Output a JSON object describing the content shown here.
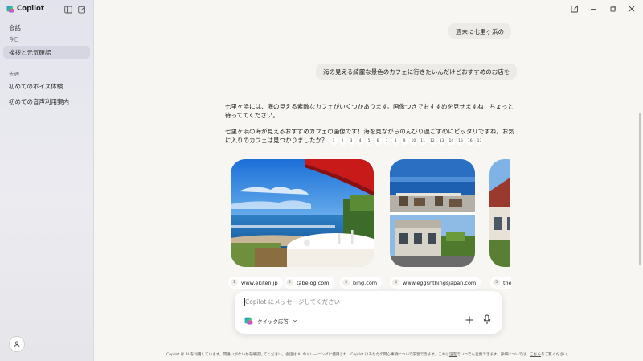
{
  "app": {
    "name": "Copilot"
  },
  "sidebar": {
    "section_title": "会話",
    "groups": [
      {
        "label": "今日",
        "items": [
          {
            "label": "挨拶と元気確認",
            "active": true
          }
        ]
      },
      {
        "label": "先週",
        "items": [
          {
            "label": "初めてのボイス体験",
            "active": false
          },
          {
            "label": "初めての音声利用案内",
            "active": false
          }
        ]
      }
    ]
  },
  "chat": {
    "user_messages": [
      "週末に七里ヶ浜の",
      "海の見える綺麗な景色のカフェに行きたいんだけどおすすめのお店を"
    ],
    "reply_paragraphs": [
      "七里ヶ浜には、海の見える素敵なカフェがいくつかあります。画像つきでおすすめを見せますね！ちょっと待っててください。",
      "七里ヶ浜の海が見えるおすすめカフェの画像です！海を見ながらのんびり過ごすのにピッタリですね。お気に入りのカフェは見つかりましたか？"
    ],
    "citations": [
      "1",
      "2",
      "3",
      "4",
      "5",
      "6",
      "7",
      "8",
      "9",
      "10",
      "11",
      "12",
      "13",
      "14",
      "15",
      "16",
      "17"
    ],
    "sources": [
      {
        "num": "1",
        "site": "www.ekiten.jp"
      },
      {
        "num": "2",
        "site": "tabelog.com"
      },
      {
        "num": "3",
        "site": "bing.com"
      },
      {
        "num": "4",
        "site": "www.eggsnthingsjapan.com"
      },
      {
        "num": "5",
        "site": "ther"
      }
    ]
  },
  "composer": {
    "placeholder": "Copilot にメッセージしてください",
    "mode_label": "クイック応答"
  },
  "footer": {
    "disclaimer_before": "Copilot は AI を利用しています。間違いがないかを確認してください。会話は AI のトレーニングに使用され、Copilot はあなたの関心事項について学習できます。これは",
    "settings_link": "設定",
    "disclaimer_middle": "でいつでも変更できます。詳細については、",
    "here_link": "こちら",
    "disclaimer_after": "をご覧ください。"
  },
  "colors": {
    "sidebar_bg": "#e6e6ee",
    "main_bg": "#f7f6f3",
    "bubble_bg": "#ecebe7",
    "active_item": "#d6d6e2"
  },
  "icons": [
    "copilot-logo-icon",
    "sidebar-toggle-icon",
    "new-chat-icon",
    "profile-icon",
    "pop-out-icon",
    "minimize-icon",
    "restore-icon",
    "close-icon",
    "plus-icon",
    "microphone-icon",
    "chevron-down-icon"
  ]
}
